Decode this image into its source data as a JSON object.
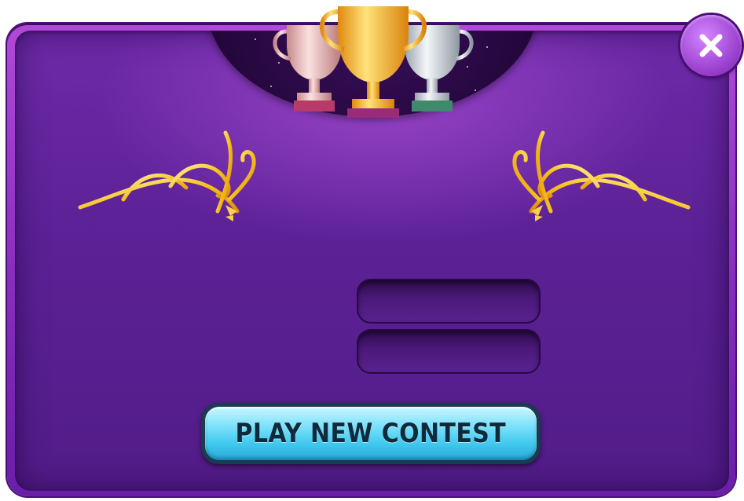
{
  "play_button": {
    "label": "PLAY NEW CONTEST"
  },
  "fields": {
    "first_value": "",
    "second_value": ""
  },
  "icons": {
    "close": "close-icon",
    "trophies": "trophies-icon",
    "flourish": "flourish-icon"
  },
  "colors": {
    "panel": "#5c2196",
    "frame": "#8a2fc0",
    "button": "#3fc8ee",
    "button_text": "#0f2a3d",
    "gold": "#f5b81c"
  }
}
